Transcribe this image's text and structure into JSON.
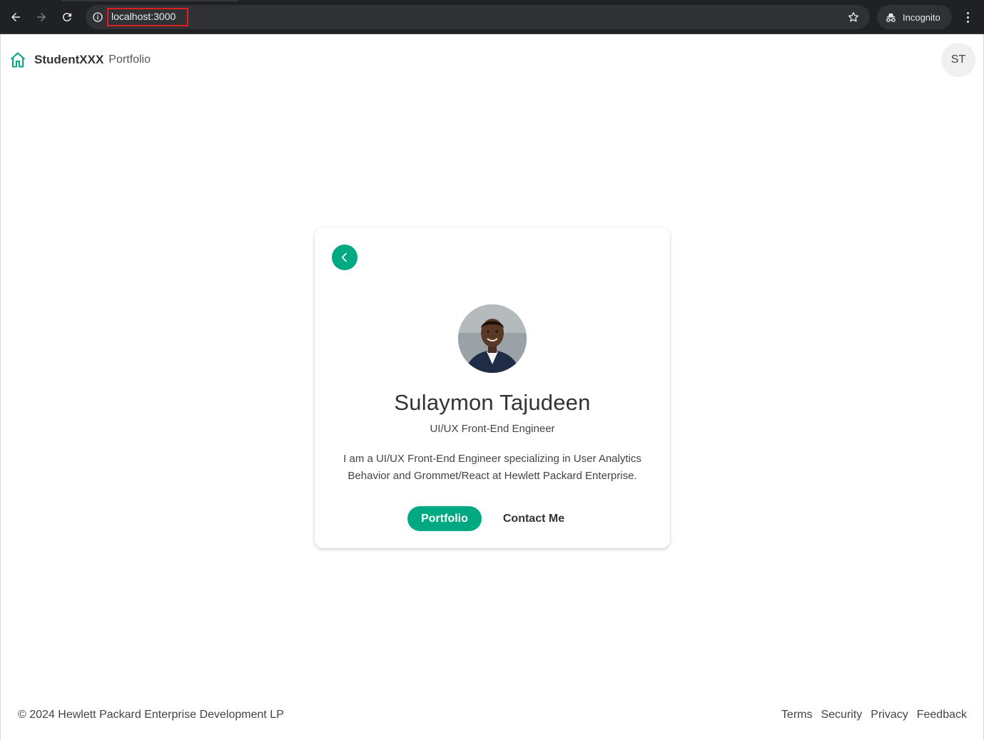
{
  "browser": {
    "url": "localhost:3000",
    "incognito_label": "Incognito",
    "icons": [
      "back-arrow-icon",
      "forward-arrow-icon",
      "reload-icon",
      "info-icon",
      "star-icon",
      "incognito-icon",
      "kebab-menu-icon"
    ]
  },
  "header": {
    "brand_name": "StudentXXX",
    "brand_suffix": "Portfolio",
    "user_initials": "ST",
    "icons": [
      "home-icon"
    ]
  },
  "card": {
    "name": "Sulaymon Tajudeen",
    "role": "UI/UX Front-End Engineer",
    "bio": "I am a UI/UX Front-End Engineer specializing in User Analytics Behavior and Grommet/React at Hewlett Packard Enterprise.",
    "portfolio_label": "Portfolio",
    "contact_label": "Contact Me",
    "icons": [
      "back-chevron-icon",
      "profile-photo"
    ]
  },
  "footer": {
    "copyright": "© 2024 Hewlett Packard Enterprise Development LP",
    "links": [
      "Terms",
      "Security",
      "Privacy",
      "Feedback"
    ]
  },
  "colors": {
    "brand_green": "#01a982",
    "chrome_bg": "#202124",
    "url_highlight": "#e01e1e"
  }
}
